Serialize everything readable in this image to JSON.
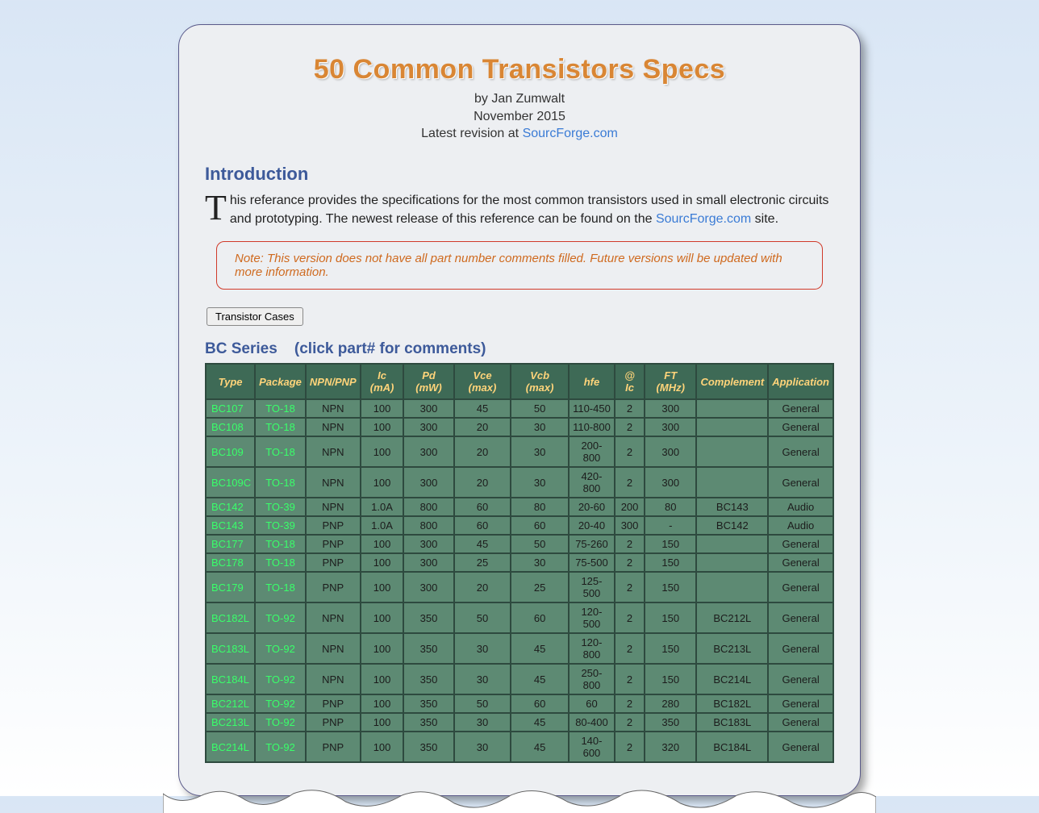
{
  "header": {
    "title": "50 Common Transistors Specs",
    "by": "by Jan Zumwalt",
    "date": "November 2015",
    "revision_prefix": "Latest revision at ",
    "revision_link": "SourcForge.com"
  },
  "intro": {
    "heading": "Introduction",
    "dropcap": "T",
    "text1": "his referance provides the specifications for the most common transistors used in small electronic circuits and prototyping. The newest release of this reference can be found on the ",
    "link": "SourcForge.com",
    "text2": " site."
  },
  "note": "Note: This version does not have all part number comments filled. Future versions will be updated with more information.",
  "button": "Transistor Cases",
  "series": {
    "name": "BC Series",
    "hint": "(click part# for comments)"
  },
  "columns": [
    "Type",
    "Package",
    "NPN/PNP",
    "Ic (mA)",
    "Pd (mW)",
    "Vce (max)",
    "Vcb (max)",
    "hfe",
    "@ Ic",
    "FT (MHz)",
    "Complement",
    "Application"
  ],
  "rows": [
    {
      "type": "BC107",
      "pkg": "TO-18",
      "np": "NPN",
      "ic": "100",
      "pd": "300",
      "vce": "45",
      "vcb": "50",
      "hfe": "110-450",
      "at": "2",
      "ft": "300",
      "comp": "",
      "app": "General"
    },
    {
      "type": "BC108",
      "pkg": "TO-18",
      "np": "NPN",
      "ic": "100",
      "pd": "300",
      "vce": "20",
      "vcb": "30",
      "hfe": "110-800",
      "at": "2",
      "ft": "300",
      "comp": "",
      "app": "General"
    },
    {
      "type": "BC109",
      "pkg": "TO-18",
      "np": "NPN",
      "ic": "100",
      "pd": "300",
      "vce": "20",
      "vcb": "30",
      "hfe": "200-800",
      "at": "2",
      "ft": "300",
      "comp": "",
      "app": "General"
    },
    {
      "type": "BC109C",
      "pkg": "TO-18",
      "np": "NPN",
      "ic": "100",
      "pd": "300",
      "vce": "20",
      "vcb": "30",
      "hfe": "420-800",
      "at": "2",
      "ft": "300",
      "comp": "",
      "app": "General"
    },
    {
      "type": "BC142",
      "pkg": "TO-39",
      "np": "NPN",
      "ic": "1.0A",
      "pd": "800",
      "vce": "60",
      "vcb": "80",
      "hfe": "20-60",
      "at": "200",
      "ft": "80",
      "comp": "BC143",
      "app": "Audio"
    },
    {
      "type": "BC143",
      "pkg": "TO-39",
      "np": "PNP",
      "ic": "1.0A",
      "pd": "800",
      "vce": "60",
      "vcb": "60",
      "hfe": "20-40",
      "at": "300",
      "ft": "-",
      "comp": "BC142",
      "app": "Audio"
    },
    {
      "type": "BC177",
      "pkg": "TO-18",
      "np": "PNP",
      "ic": "100",
      "pd": "300",
      "vce": "45",
      "vcb": "50",
      "hfe": "75-260",
      "at": "2",
      "ft": "150",
      "comp": "",
      "app": "General"
    },
    {
      "type": "BC178",
      "pkg": "TO-18",
      "np": "PNP",
      "ic": "100",
      "pd": "300",
      "vce": "25",
      "vcb": "30",
      "hfe": "75-500",
      "at": "2",
      "ft": "150",
      "comp": "",
      "app": "General"
    },
    {
      "type": "BC179",
      "pkg": "TO-18",
      "np": "PNP",
      "ic": "100",
      "pd": "300",
      "vce": "20",
      "vcb": "25",
      "hfe": "125-500",
      "at": "2",
      "ft": "150",
      "comp": "",
      "app": "General"
    },
    {
      "type": "BC182L",
      "pkg": "TO-92",
      "np": "NPN",
      "ic": "100",
      "pd": "350",
      "vce": "50",
      "vcb": "60",
      "hfe": "120-500",
      "at": "2",
      "ft": "150",
      "comp": "BC212L",
      "app": "General"
    },
    {
      "type": "BC183L",
      "pkg": "TO-92",
      "np": "NPN",
      "ic": "100",
      "pd": "350",
      "vce": "30",
      "vcb": "45",
      "hfe": "120-800",
      "at": "2",
      "ft": "150",
      "comp": "BC213L",
      "app": "General"
    },
    {
      "type": "BC184L",
      "pkg": "TO-92",
      "np": "NPN",
      "ic": "100",
      "pd": "350",
      "vce": "30",
      "vcb": "45",
      "hfe": "250-800",
      "at": "2",
      "ft": "150",
      "comp": "BC214L",
      "app": "General"
    },
    {
      "type": "BC212L",
      "pkg": "TO-92",
      "np": "PNP",
      "ic": "100",
      "pd": "350",
      "vce": "50",
      "vcb": "60",
      "hfe": "60",
      "at": "2",
      "ft": "280",
      "comp": "BC182L",
      "app": "General"
    },
    {
      "type": "BC213L",
      "pkg": "TO-92",
      "np": "PNP",
      "ic": "100",
      "pd": "350",
      "vce": "30",
      "vcb": "45",
      "hfe": "80-400",
      "at": "2",
      "ft": "350",
      "comp": "BC183L",
      "app": "General"
    },
    {
      "type": "BC214L",
      "pkg": "TO-92",
      "np": "PNP",
      "ic": "100",
      "pd": "350",
      "vce": "30",
      "vcb": "45",
      "hfe": "140-600",
      "at": "2",
      "ft": "320",
      "comp": "BC184L",
      "app": "General"
    }
  ]
}
